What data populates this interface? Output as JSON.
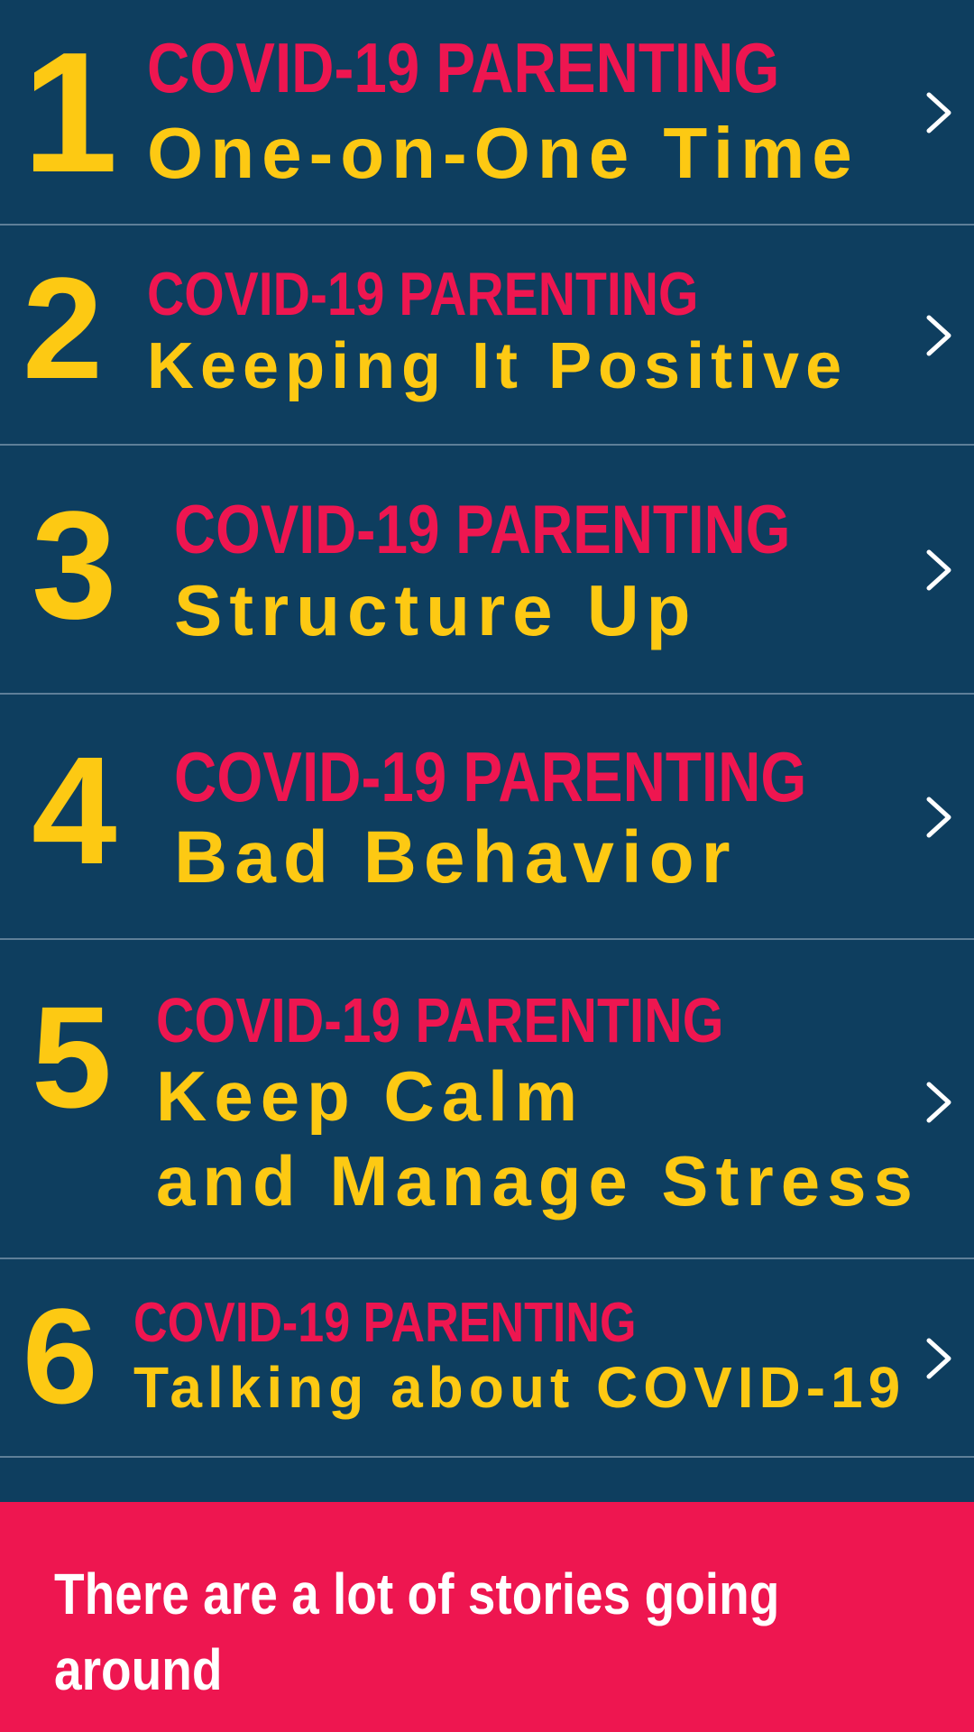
{
  "items": [
    {
      "number": "1",
      "kicker": "COVID-19 PARENTING",
      "title_lines": [
        "One-on-One Time"
      ]
    },
    {
      "number": "2",
      "kicker": "COVID-19 PARENTING",
      "title_lines": [
        "Keeping It Positive"
      ]
    },
    {
      "number": "3",
      "kicker": "COVID-19 PARENTING",
      "title_lines": [
        "Structure Up"
      ]
    },
    {
      "number": "4",
      "kicker": "COVID-19 PARENTING",
      "title_lines": [
        "Bad Behavior"
      ]
    },
    {
      "number": "5",
      "kicker": "COVID-19 PARENTING",
      "title_lines": [
        "Keep Calm",
        "and Manage Stress"
      ]
    },
    {
      "number": "6",
      "kicker": "COVID-19 PARENTING",
      "title_lines": [
        "Talking about COVID-19"
      ]
    }
  ],
  "banner": {
    "text": "There are a lot of stories going around"
  },
  "colors": {
    "background": "#0e3e5f",
    "number": "#fdc913",
    "kicker": "#ee1650",
    "divider": "#5e7f98",
    "banner": "#ee1650",
    "banner_text": "#ffffff"
  },
  "icons": {
    "row_arrow": "chevron-right-icon"
  }
}
